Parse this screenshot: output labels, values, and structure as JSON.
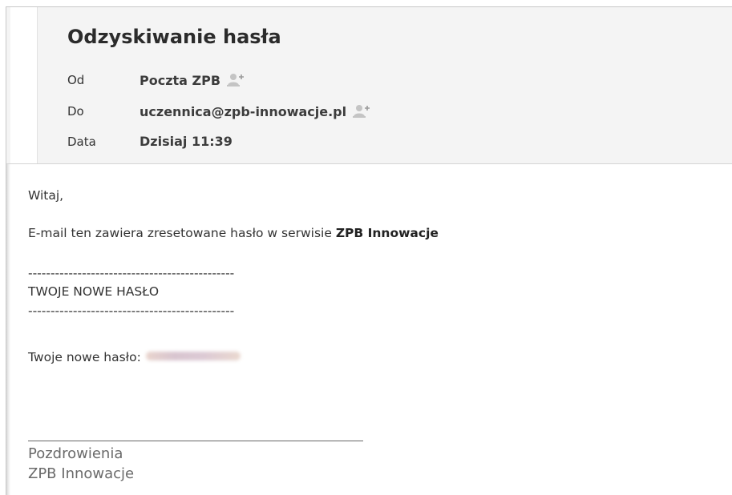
{
  "message": {
    "subject": "Odzyskiwanie hasła",
    "headers": [
      {
        "label": "Od",
        "value": "Poczta ZPB",
        "add_contact": true
      },
      {
        "label": "Do",
        "value": "uczennica@zpb-innowacje.pl",
        "add_contact": true
      },
      {
        "label": "Data",
        "value": "Dzisiaj 11:39",
        "add_contact": false
      }
    ],
    "body": {
      "greeting": "Witaj,",
      "intro_text": "E-mail ten zawiera zresetowane hasło w serwisie ",
      "intro_bold": "ZPB Innowacje",
      "divider_top": "----------------------------------------------",
      "section_title": "TWOJE NOWE HASŁO",
      "divider_bottom": "----------------------------------------------",
      "password_label": "Twoje nowe hasło:"
    },
    "signature": {
      "line1": "Pozdrowienia",
      "line2": "ZPB Innowacje"
    }
  },
  "icons": {
    "add_contact": "add-contact-icon"
  },
  "colors": {
    "header_bg": "#f4f4f4",
    "text": "#333333",
    "signature": "#6a6a6a"
  }
}
